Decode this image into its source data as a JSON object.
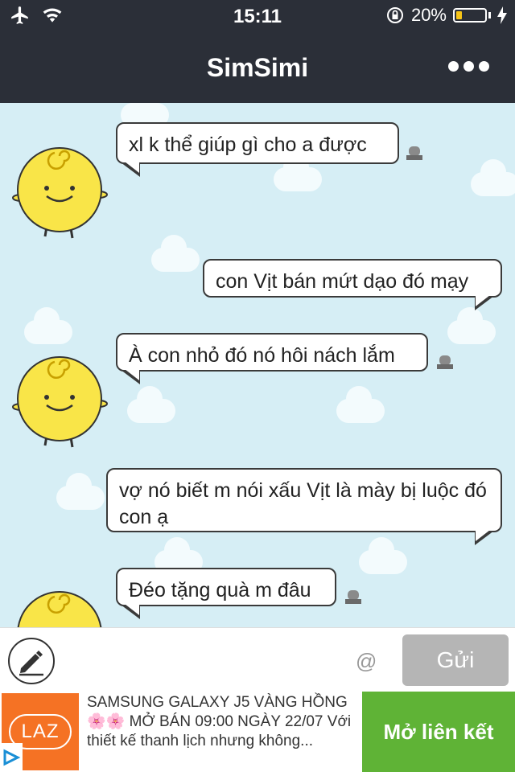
{
  "status_bar": {
    "time": "15:11",
    "battery_percent": "20%",
    "battery_level": 0.2
  },
  "header": {
    "title": "SimSimi"
  },
  "messages": [
    {
      "sender": "simsimi",
      "text": "xl k thể giúp gì cho a được"
    },
    {
      "sender": "user",
      "text": "con Vịt bán mứt dạo đó mạy"
    },
    {
      "sender": "simsimi",
      "text": "À con nhỏ đó nó hôi nách lắm"
    },
    {
      "sender": "user",
      "text": "vợ nó biết m nói xấu Vịt là mày bị luộc đó con ạ"
    },
    {
      "sender": "simsimi",
      "text": "Đéo tặng quà m đâu"
    }
  ],
  "input": {
    "at_symbol": "@",
    "send_label": "Gửi"
  },
  "ad": {
    "logo_text": "LAZ",
    "title": "SAMSUNG GALAXY J5 VÀNG HỒNG 🌸🌸 MỞ BÁN 09:00 NGÀY 22/07",
    "body": "Với thiết kế thanh lịch nhưng không...",
    "cta_label": "Mở liên kết"
  },
  "colors": {
    "header_bg": "#2b2f38",
    "chat_bg": "#d6eef5",
    "send_button": "#b5b5b5",
    "cta_bg": "#5fb336",
    "ad_logo_bg": "#f57224",
    "avatar": "#f9e548"
  }
}
